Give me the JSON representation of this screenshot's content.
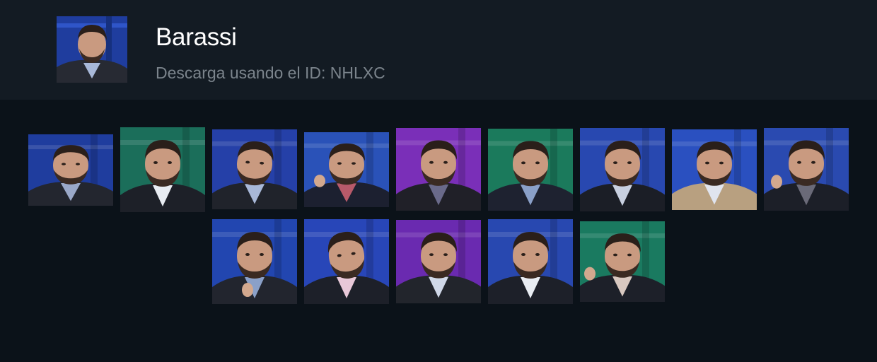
{
  "pack": {
    "title": "Barassi",
    "download_text": "Descarga usando el ID: NHLXC",
    "cover_icon": "person-portrait-icon"
  },
  "stickers": [
    {
      "label": "sticker-1",
      "background": "#1f3d9e",
      "suit": "#23262f",
      "shirt": "#9aa8c8",
      "expression": "eyes-up"
    },
    {
      "label": "sticker-2",
      "background": "#1b6e5a",
      "suit": "#1d2028",
      "shirt": "#e8ecf2",
      "expression": "smirk"
    },
    {
      "label": "sticker-3",
      "background": "#2540a8",
      "suit": "#20232b",
      "shirt": "#a8b8d8",
      "expression": "side-look"
    },
    {
      "label": "sticker-4",
      "background": "#2a52b8",
      "suit": "#1c2030",
      "shirt": "#b85a6a",
      "expression": "spray"
    },
    {
      "label": "sticker-5",
      "background": "#7a2fb8",
      "suit": "#202028",
      "shirt": "#6a6a8a",
      "expression": "grimace"
    },
    {
      "label": "sticker-6",
      "background": "#1b7a5c",
      "suit": "#1e2230",
      "shirt": "#8aa0c8",
      "expression": "neutral"
    },
    {
      "label": "sticker-7",
      "background": "#2848b0",
      "suit": "#1b1e26",
      "shirt": "#c8d0e0",
      "expression": "frown"
    },
    {
      "label": "sticker-8",
      "background": "#2a50c0",
      "suit": "#b8a080",
      "shirt": "#e0e4ee",
      "expression": "smile"
    },
    {
      "label": "sticker-9",
      "background": "#2a4ab0",
      "suit": "#1c1f28",
      "shirt": "#6a6a78",
      "expression": "thumbs-up"
    },
    {
      "label": "sticker-10",
      "background": "#2246b0",
      "suit": "#22252e",
      "shirt": "#8aa0c8",
      "expression": "hand-chest"
    },
    {
      "label": "sticker-11",
      "background": "#2846b8",
      "suit": "#1d2029",
      "shirt": "#e8c8d8",
      "expression": "tilt"
    },
    {
      "label": "sticker-12",
      "background": "#6a2ab0",
      "suit": "#22252c",
      "shirt": "#d0d8e8",
      "expression": "pout"
    },
    {
      "label": "sticker-13",
      "background": "#2848b0",
      "suit": "#1d2029",
      "shirt": "#e8ecf2",
      "expression": "surprised"
    },
    {
      "label": "sticker-14",
      "background": "#1a7a60",
      "suit": "#1d2029",
      "shirt": "#d8c8c0",
      "expression": "shrug"
    }
  ]
}
